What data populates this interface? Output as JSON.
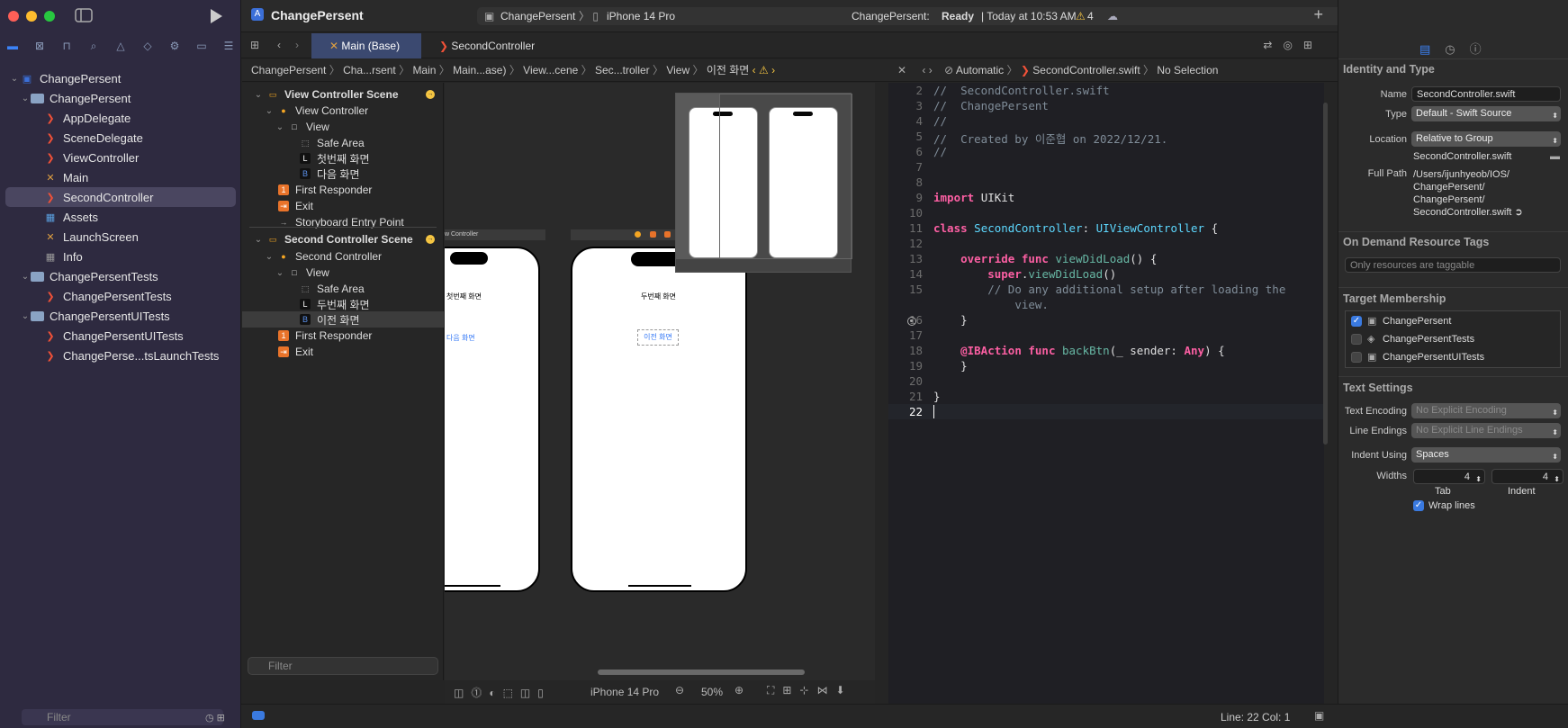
{
  "app": {
    "project_title": "ChangePersent",
    "scheme_target": "ChangePersent",
    "scheme_device": "iPhone 14 Pro",
    "status_prefix": "ChangePersent:",
    "status_state": "Ready",
    "status_time": "| Today at 10:53 AM",
    "warning_count": "4"
  },
  "navigator": {
    "items": [
      {
        "label": "ChangePersent",
        "kind": "project"
      },
      {
        "label": "ChangePersent",
        "kind": "folder"
      },
      {
        "label": "AppDelegate",
        "kind": "swift"
      },
      {
        "label": "SceneDelegate",
        "kind": "swift"
      },
      {
        "label": "ViewController",
        "kind": "swift"
      },
      {
        "label": "Main",
        "kind": "xib"
      },
      {
        "label": "SecondController",
        "kind": "swift"
      },
      {
        "label": "Assets",
        "kind": "assets"
      },
      {
        "label": "LaunchScreen",
        "kind": "xib"
      },
      {
        "label": "Info",
        "kind": "info"
      },
      {
        "label": "ChangePersentTests",
        "kind": "folder"
      },
      {
        "label": "ChangePersentTests",
        "kind": "swift"
      },
      {
        "label": "ChangePersentUITests",
        "kind": "folder"
      },
      {
        "label": "ChangePersentUITests",
        "kind": "swift"
      },
      {
        "label": "ChangePerse...tsLaunchTests",
        "kind": "swift"
      }
    ],
    "filter_placeholder": "Filter"
  },
  "tabs": [
    {
      "label": "Main (Base)"
    },
    {
      "label": "SecondController"
    }
  ],
  "jumpbar_left": [
    "ChangePersent",
    "Cha...rsent",
    "Main",
    "Main...ase)",
    "View...cene",
    "Sec...troller",
    "View",
    "이전 화면"
  ],
  "jumpbar_right": [
    "Automatic",
    "SecondController.swift",
    "No Selection"
  ],
  "outline": {
    "items": [
      {
        "label": "View Controller Scene",
        "kind": "scene"
      },
      {
        "label": "View Controller",
        "kind": "vc"
      },
      {
        "label": "View",
        "kind": "view"
      },
      {
        "label": "Safe Area",
        "kind": "safe"
      },
      {
        "label": "첫번째 화면",
        "kind": "labelL"
      },
      {
        "label": "다음 화면",
        "kind": "buttonB"
      },
      {
        "label": "First Responder",
        "kind": "fr"
      },
      {
        "label": "Exit",
        "kind": "exit"
      },
      {
        "label": "Storyboard Entry Point",
        "kind": "entry"
      },
      {
        "label": "Second Controller Scene",
        "kind": "scene"
      },
      {
        "label": "Second Controller",
        "kind": "vc"
      },
      {
        "label": "View",
        "kind": "view"
      },
      {
        "label": "Safe Area",
        "kind": "safe"
      },
      {
        "label": "두번째 화면",
        "kind": "labelL"
      },
      {
        "label": "이전 화면",
        "kind": "buttonB"
      },
      {
        "label": "First Responder",
        "kind": "fr"
      },
      {
        "label": "Exit",
        "kind": "exit"
      }
    ],
    "filter_placeholder": "Filter"
  },
  "canvas": {
    "scene1_header": "w Controller",
    "scene1_label": "첫번째 화면",
    "scene1_button": "다음 화면",
    "scene2_label": "두번째 화면",
    "scene2_button": "이전 화면",
    "device": "iPhone 14 Pro",
    "zoom": "50%"
  },
  "code": [
    {
      "n": "2",
      "html": "<span class=\"cm\">//  SecondController.swift</span>"
    },
    {
      "n": "3",
      "html": "<span class=\"cm\">//  ChangePersent</span>"
    },
    {
      "n": "4",
      "html": "<span class=\"cm\">//</span>"
    },
    {
      "n": "5",
      "html": "<span class=\"cm\">//  Created by 이준협 on 2022/12/21.</span>"
    },
    {
      "n": "6",
      "html": "<span class=\"cm\">//</span>"
    },
    {
      "n": "7",
      "html": ""
    },
    {
      "n": "8",
      "html": ""
    },
    {
      "n": "9",
      "html": "<span class=\"kw\">import</span> <span class=\"pl\">UIKit</span>"
    },
    {
      "n": "10",
      "html": ""
    },
    {
      "n": "11",
      "html": "<span class=\"kw\">class</span> <span class=\"ty\">SecondController</span><span class=\"pl\">: </span><span class=\"ty\">UIViewController</span><span class=\"pl\"> {</span>"
    },
    {
      "n": "12",
      "html": ""
    },
    {
      "n": "13",
      "html": "    <span class=\"kw\">override func</span> <span class=\"fn\">viewDidLoad</span><span class=\"pl\">() {</span>"
    },
    {
      "n": "14",
      "html": "        <span class=\"kw\">super</span><span class=\"pl\">.</span><span class=\"fn\">viewDidLoad</span><span class=\"pl\">()</span>"
    },
    {
      "n": "15",
      "html": "        <span class=\"cm\">// Do any additional setup after loading the</span>"
    },
    {
      "n": "",
      "html": "            <span class=\"cm\">view.</span>"
    },
    {
      "n": "16",
      "html": "    <span class=\"pl\">}</span>"
    },
    {
      "n": "17",
      "html": ""
    },
    {
      "n": "18",
      "html": "    <span class=\"kw\">@IBAction func</span> <span class=\"fn\">backBtn</span><span class=\"pl\">(_ sender: </span><span class=\"kw\">Any</span><span class=\"pl\">) {</span>"
    },
    {
      "n": "19",
      "html": "    <span class=\"pl\">}</span>"
    },
    {
      "n": "20",
      "html": ""
    },
    {
      "n": "21",
      "html": "<span class=\"pl\">}</span>"
    },
    {
      "n": "22",
      "html": ""
    }
  ],
  "inspector": {
    "identity_title": "Identity and Type",
    "name_label": "Name",
    "name_value": "SecondController.swift",
    "type_label": "Type",
    "type_value": "Default - Swift Source",
    "location_label": "Location",
    "location_value": "Relative to Group",
    "location_file": "SecondController.swift",
    "fullpath_label": "Full Path",
    "fullpath_lines": [
      "/Users/ijunhyeob/IOS/",
      "ChangePersent/",
      "ChangePersent/",
      "SecondController.swift"
    ],
    "odr_title": "On Demand Resource Tags",
    "odr_placeholder": "Only resources are taggable",
    "target_title": "Target Membership",
    "targets": [
      {
        "label": "ChangePersent",
        "checked": true
      },
      {
        "label": "ChangePersentTests",
        "checked": false
      },
      {
        "label": "ChangePersentUITests",
        "checked": false
      }
    ],
    "text_title": "Text Settings",
    "encoding_label": "Text Encoding",
    "encoding_value": "No Explicit Encoding",
    "endings_label": "Line Endings",
    "endings_value": "No Explicit Line Endings",
    "indent_label": "Indent Using",
    "indent_value": "Spaces",
    "widths_label": "Widths",
    "tab_value": "4",
    "indent_width_value": "4",
    "tab_caption": "Tab",
    "indent_caption": "Indent",
    "wrap_label": "Wrap lines"
  },
  "statusbar": {
    "position": "Line: 22  Col: 1"
  }
}
